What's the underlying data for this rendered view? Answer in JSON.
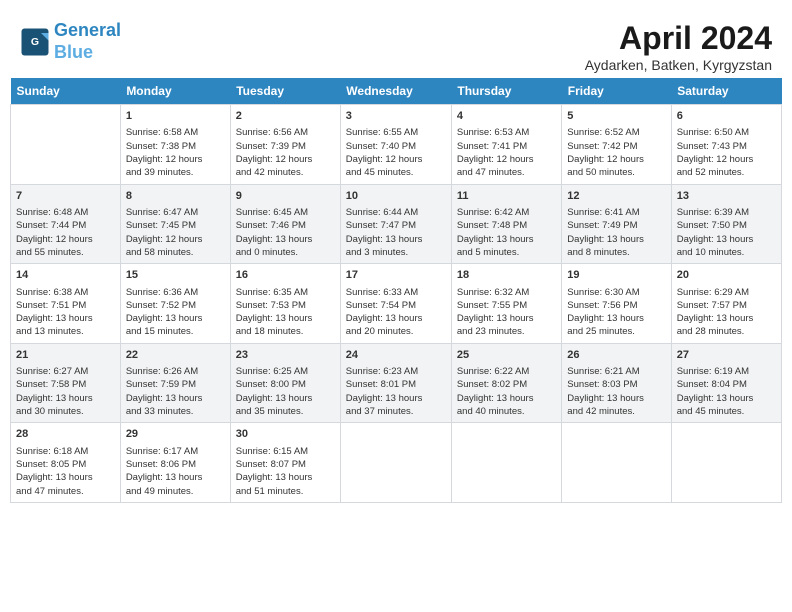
{
  "header": {
    "logo_line1": "General",
    "logo_line2": "Blue",
    "month_title": "April 2024",
    "subtitle": "Aydarken, Batken, Kyrgyzstan"
  },
  "days_of_week": [
    "Sunday",
    "Monday",
    "Tuesday",
    "Wednesday",
    "Thursday",
    "Friday",
    "Saturday"
  ],
  "weeks": [
    [
      {
        "day": "",
        "info": ""
      },
      {
        "day": "1",
        "info": "Sunrise: 6:58 AM\nSunset: 7:38 PM\nDaylight: 12 hours\nand 39 minutes."
      },
      {
        "day": "2",
        "info": "Sunrise: 6:56 AM\nSunset: 7:39 PM\nDaylight: 12 hours\nand 42 minutes."
      },
      {
        "day": "3",
        "info": "Sunrise: 6:55 AM\nSunset: 7:40 PM\nDaylight: 12 hours\nand 45 minutes."
      },
      {
        "day": "4",
        "info": "Sunrise: 6:53 AM\nSunset: 7:41 PM\nDaylight: 12 hours\nand 47 minutes."
      },
      {
        "day": "5",
        "info": "Sunrise: 6:52 AM\nSunset: 7:42 PM\nDaylight: 12 hours\nand 50 minutes."
      },
      {
        "day": "6",
        "info": "Sunrise: 6:50 AM\nSunset: 7:43 PM\nDaylight: 12 hours\nand 52 minutes."
      }
    ],
    [
      {
        "day": "7",
        "info": "Sunrise: 6:48 AM\nSunset: 7:44 PM\nDaylight: 12 hours\nand 55 minutes."
      },
      {
        "day": "8",
        "info": "Sunrise: 6:47 AM\nSunset: 7:45 PM\nDaylight: 12 hours\nand 58 minutes."
      },
      {
        "day": "9",
        "info": "Sunrise: 6:45 AM\nSunset: 7:46 PM\nDaylight: 13 hours\nand 0 minutes."
      },
      {
        "day": "10",
        "info": "Sunrise: 6:44 AM\nSunset: 7:47 PM\nDaylight: 13 hours\nand 3 minutes."
      },
      {
        "day": "11",
        "info": "Sunrise: 6:42 AM\nSunset: 7:48 PM\nDaylight: 13 hours\nand 5 minutes."
      },
      {
        "day": "12",
        "info": "Sunrise: 6:41 AM\nSunset: 7:49 PM\nDaylight: 13 hours\nand 8 minutes."
      },
      {
        "day": "13",
        "info": "Sunrise: 6:39 AM\nSunset: 7:50 PM\nDaylight: 13 hours\nand 10 minutes."
      }
    ],
    [
      {
        "day": "14",
        "info": "Sunrise: 6:38 AM\nSunset: 7:51 PM\nDaylight: 13 hours\nand 13 minutes."
      },
      {
        "day": "15",
        "info": "Sunrise: 6:36 AM\nSunset: 7:52 PM\nDaylight: 13 hours\nand 15 minutes."
      },
      {
        "day": "16",
        "info": "Sunrise: 6:35 AM\nSunset: 7:53 PM\nDaylight: 13 hours\nand 18 minutes."
      },
      {
        "day": "17",
        "info": "Sunrise: 6:33 AM\nSunset: 7:54 PM\nDaylight: 13 hours\nand 20 minutes."
      },
      {
        "day": "18",
        "info": "Sunrise: 6:32 AM\nSunset: 7:55 PM\nDaylight: 13 hours\nand 23 minutes."
      },
      {
        "day": "19",
        "info": "Sunrise: 6:30 AM\nSunset: 7:56 PM\nDaylight: 13 hours\nand 25 minutes."
      },
      {
        "day": "20",
        "info": "Sunrise: 6:29 AM\nSunset: 7:57 PM\nDaylight: 13 hours\nand 28 minutes."
      }
    ],
    [
      {
        "day": "21",
        "info": "Sunrise: 6:27 AM\nSunset: 7:58 PM\nDaylight: 13 hours\nand 30 minutes."
      },
      {
        "day": "22",
        "info": "Sunrise: 6:26 AM\nSunset: 7:59 PM\nDaylight: 13 hours\nand 33 minutes."
      },
      {
        "day": "23",
        "info": "Sunrise: 6:25 AM\nSunset: 8:00 PM\nDaylight: 13 hours\nand 35 minutes."
      },
      {
        "day": "24",
        "info": "Sunrise: 6:23 AM\nSunset: 8:01 PM\nDaylight: 13 hours\nand 37 minutes."
      },
      {
        "day": "25",
        "info": "Sunrise: 6:22 AM\nSunset: 8:02 PM\nDaylight: 13 hours\nand 40 minutes."
      },
      {
        "day": "26",
        "info": "Sunrise: 6:21 AM\nSunset: 8:03 PM\nDaylight: 13 hours\nand 42 minutes."
      },
      {
        "day": "27",
        "info": "Sunrise: 6:19 AM\nSunset: 8:04 PM\nDaylight: 13 hours\nand 45 minutes."
      }
    ],
    [
      {
        "day": "28",
        "info": "Sunrise: 6:18 AM\nSunset: 8:05 PM\nDaylight: 13 hours\nand 47 minutes."
      },
      {
        "day": "29",
        "info": "Sunrise: 6:17 AM\nSunset: 8:06 PM\nDaylight: 13 hours\nand 49 minutes."
      },
      {
        "day": "30",
        "info": "Sunrise: 6:15 AM\nSunset: 8:07 PM\nDaylight: 13 hours\nand 51 minutes."
      },
      {
        "day": "",
        "info": ""
      },
      {
        "day": "",
        "info": ""
      },
      {
        "day": "",
        "info": ""
      },
      {
        "day": "",
        "info": ""
      }
    ]
  ]
}
